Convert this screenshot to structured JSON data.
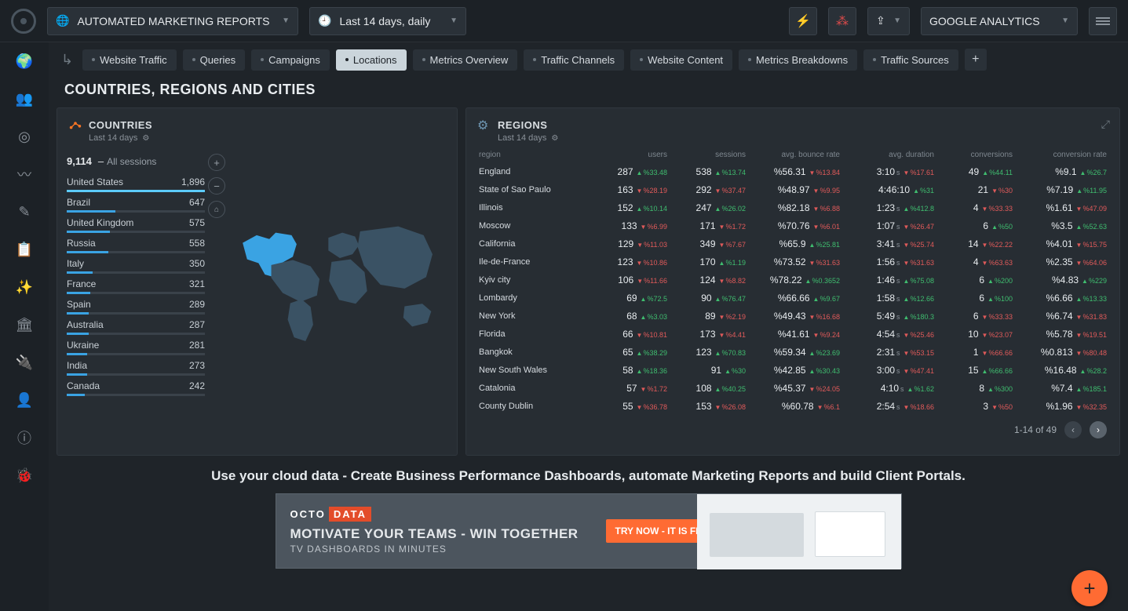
{
  "topbar": {
    "report_select": "AUTOMATED MARKETING REPORTS",
    "date_range": "Last 14 days, daily",
    "source_select": "GOOGLE ANALYTICS"
  },
  "tabs": [
    {
      "label": "Website Traffic",
      "active": false
    },
    {
      "label": "Queries",
      "active": false
    },
    {
      "label": "Campaigns",
      "active": false
    },
    {
      "label": "Locations",
      "active": true
    },
    {
      "label": "Metrics Overview",
      "active": false
    },
    {
      "label": "Traffic Channels",
      "active": false
    },
    {
      "label": "Website Content",
      "active": false
    },
    {
      "label": "Metrics Breakdowns",
      "active": false
    },
    {
      "label": "Traffic Sources",
      "active": false
    }
  ],
  "page_title": "COUNTRIES, REGIONS AND CITIES",
  "countries_panel": {
    "title": "COUNTRIES",
    "subtitle": "Last 14 days",
    "total_value": "9,114",
    "total_label": "All sessions",
    "rows": [
      {
        "name": "United States",
        "value": "1,896",
        "pct": 100
      },
      {
        "name": "Brazil",
        "value": "647",
        "pct": 35
      },
      {
        "name": "United Kingdom",
        "value": "575",
        "pct": 31
      },
      {
        "name": "Russia",
        "value": "558",
        "pct": 30
      },
      {
        "name": "Italy",
        "value": "350",
        "pct": 19
      },
      {
        "name": "France",
        "value": "321",
        "pct": 17
      },
      {
        "name": "Spain",
        "value": "289",
        "pct": 16
      },
      {
        "name": "Australia",
        "value": "287",
        "pct": 16
      },
      {
        "name": "Ukraine",
        "value": "281",
        "pct": 15
      },
      {
        "name": "India",
        "value": "273",
        "pct": 15
      },
      {
        "name": "Canada",
        "value": "242",
        "pct": 13
      }
    ]
  },
  "regions_panel": {
    "title": "REGIONS",
    "subtitle": "Last 14 days",
    "columns": [
      "region",
      "users",
      "sessions",
      "avg. bounce rate",
      "avg. duration",
      "conversions",
      "conversion rate"
    ],
    "rows": [
      {
        "region": "England",
        "users": "287",
        "users_chg": "%33.48",
        "users_dir": "up",
        "sessions": "538",
        "sessions_chg": "%13.74",
        "sessions_dir": "up",
        "bounce": "%56.31",
        "bounce_chg": "%13.84",
        "bounce_dir": "dn",
        "dur": "3:10",
        "dur_chg": "%17.61",
        "dur_dir": "dn",
        "conv": "49",
        "conv_chg": "%44.11",
        "conv_dir": "up",
        "rate": "%9.1",
        "rate_chg": "%26.7",
        "rate_dir": "up"
      },
      {
        "region": "State of Sao Paulo",
        "users": "163",
        "users_chg": "%28.19",
        "users_dir": "dn",
        "sessions": "292",
        "sessions_chg": "%37.47",
        "sessions_dir": "dn",
        "bounce": "%48.97",
        "bounce_chg": "%9.95",
        "bounce_dir": "dn",
        "dur": "4:46:10",
        "dur_chg": "%31",
        "dur_dir": "up",
        "conv": "21",
        "conv_chg": "%30",
        "conv_dir": "dn",
        "rate": "%7.19",
        "rate_chg": "%11.95",
        "rate_dir": "up"
      },
      {
        "region": "Illinois",
        "users": "152",
        "users_chg": "%10.14",
        "users_dir": "up",
        "sessions": "247",
        "sessions_chg": "%26.02",
        "sessions_dir": "up",
        "bounce": "%82.18",
        "bounce_chg": "%6.88",
        "bounce_dir": "dn",
        "dur": "1:23",
        "dur_chg": "%412.8",
        "dur_dir": "up",
        "conv": "4",
        "conv_chg": "%33.33",
        "conv_dir": "dn",
        "rate": "%1.61",
        "rate_chg": "%47.09",
        "rate_dir": "dn"
      },
      {
        "region": "Moscow",
        "users": "133",
        "users_chg": "%6.99",
        "users_dir": "dn",
        "sessions": "171",
        "sessions_chg": "%1.72",
        "sessions_dir": "dn",
        "bounce": "%70.76",
        "bounce_chg": "%6.01",
        "bounce_dir": "dn",
        "dur": "1:07",
        "dur_chg": "%26.47",
        "dur_dir": "dn",
        "conv": "6",
        "conv_chg": "%50",
        "conv_dir": "up",
        "rate": "%3.5",
        "rate_chg": "%52.63",
        "rate_dir": "up"
      },
      {
        "region": "California",
        "users": "129",
        "users_chg": "%11.03",
        "users_dir": "dn",
        "sessions": "349",
        "sessions_chg": "%7.67",
        "sessions_dir": "dn",
        "bounce": "%65.9",
        "bounce_chg": "%25.81",
        "bounce_dir": "up",
        "dur": "3:41",
        "dur_chg": "%25.74",
        "dur_dir": "dn",
        "conv": "14",
        "conv_chg": "%22.22",
        "conv_dir": "dn",
        "rate": "%4.01",
        "rate_chg": "%15.75",
        "rate_dir": "dn"
      },
      {
        "region": "Ile-de-France",
        "users": "123",
        "users_chg": "%10.86",
        "users_dir": "dn",
        "sessions": "170",
        "sessions_chg": "%1.19",
        "sessions_dir": "up",
        "bounce": "%73.52",
        "bounce_chg": "%31.63",
        "bounce_dir": "dn",
        "dur": "1:56",
        "dur_chg": "%31.63",
        "dur_dir": "dn",
        "conv": "4",
        "conv_chg": "%63.63",
        "conv_dir": "dn",
        "rate": "%2.35",
        "rate_chg": "%64.06",
        "rate_dir": "dn"
      },
      {
        "region": "Kyiv city",
        "users": "106",
        "users_chg": "%11.66",
        "users_dir": "dn",
        "sessions": "124",
        "sessions_chg": "%8.82",
        "sessions_dir": "dn",
        "bounce": "%78.22",
        "bounce_chg": "%0.3652",
        "bounce_dir": "up",
        "dur": "1:46",
        "dur_chg": "%75.08",
        "dur_dir": "up",
        "conv": "6",
        "conv_chg": "%200",
        "conv_dir": "up",
        "rate": "%4.83",
        "rate_chg": "%229",
        "rate_dir": "up"
      },
      {
        "region": "Lombardy",
        "users": "69",
        "users_chg": "%72.5",
        "users_dir": "up",
        "sessions": "90",
        "sessions_chg": "%76.47",
        "sessions_dir": "up",
        "bounce": "%66.66",
        "bounce_chg": "%9.67",
        "bounce_dir": "up",
        "dur": "1:58",
        "dur_chg": "%12.66",
        "dur_dir": "up",
        "conv": "6",
        "conv_chg": "%100",
        "conv_dir": "up",
        "rate": "%6.66",
        "rate_chg": "%13.33",
        "rate_dir": "up"
      },
      {
        "region": "New York",
        "users": "68",
        "users_chg": "%3.03",
        "users_dir": "up",
        "sessions": "89",
        "sessions_chg": "%2.19",
        "sessions_dir": "dn",
        "bounce": "%49.43",
        "bounce_chg": "%16.68",
        "bounce_dir": "dn",
        "dur": "5:49",
        "dur_chg": "%180.3",
        "dur_dir": "up",
        "conv": "6",
        "conv_chg": "%33.33",
        "conv_dir": "dn",
        "rate": "%6.74",
        "rate_chg": "%31.83",
        "rate_dir": "dn"
      },
      {
        "region": "Florida",
        "users": "66",
        "users_chg": "%10.81",
        "users_dir": "dn",
        "sessions": "173",
        "sessions_chg": "%4.41",
        "sessions_dir": "dn",
        "bounce": "%41.61",
        "bounce_chg": "%9.24",
        "bounce_dir": "dn",
        "dur": "4:54",
        "dur_chg": "%25.46",
        "dur_dir": "dn",
        "conv": "10",
        "conv_chg": "%23.07",
        "conv_dir": "dn",
        "rate": "%5.78",
        "rate_chg": "%19.51",
        "rate_dir": "dn"
      },
      {
        "region": "Bangkok",
        "users": "65",
        "users_chg": "%38.29",
        "users_dir": "up",
        "sessions": "123",
        "sessions_chg": "%70.83",
        "sessions_dir": "up",
        "bounce": "%59.34",
        "bounce_chg": "%23.69",
        "bounce_dir": "up",
        "dur": "2:31",
        "dur_chg": "%53.15",
        "dur_dir": "dn",
        "conv": "1",
        "conv_chg": "%66.66",
        "conv_dir": "dn",
        "rate": "%0.813",
        "rate_chg": "%80.48",
        "rate_dir": "dn"
      },
      {
        "region": "New South Wales",
        "users": "58",
        "users_chg": "%18.36",
        "users_dir": "up",
        "sessions": "91",
        "sessions_chg": "%30",
        "sessions_dir": "up",
        "bounce": "%42.85",
        "bounce_chg": "%30.43",
        "bounce_dir": "up",
        "dur": "3:00",
        "dur_chg": "%47.41",
        "dur_dir": "dn",
        "conv": "15",
        "conv_chg": "%66.66",
        "conv_dir": "up",
        "rate": "%16.48",
        "rate_chg": "%28.2",
        "rate_dir": "up"
      },
      {
        "region": "Catalonia",
        "users": "57",
        "users_chg": "%1.72",
        "users_dir": "dn",
        "sessions": "108",
        "sessions_chg": "%40.25",
        "sessions_dir": "up",
        "bounce": "%45.37",
        "bounce_chg": "%24.05",
        "bounce_dir": "dn",
        "dur": "4:10",
        "dur_chg": "%1.62",
        "dur_dir": "up",
        "conv": "8",
        "conv_chg": "%300",
        "conv_dir": "up",
        "rate": "%7.4",
        "rate_chg": "%185.1",
        "rate_dir": "up"
      },
      {
        "region": "County Dublin",
        "users": "55",
        "users_chg": "%36.78",
        "users_dir": "dn",
        "sessions": "153",
        "sessions_chg": "%26.08",
        "sessions_dir": "dn",
        "bounce": "%60.78",
        "bounce_chg": "%6.1",
        "bounce_dir": "dn",
        "dur": "2:54",
        "dur_chg": "%18.66",
        "dur_dir": "dn",
        "conv": "3",
        "conv_chg": "%50",
        "conv_dir": "dn",
        "rate": "%1.96",
        "rate_chg": "%32.35",
        "rate_dir": "dn"
      }
    ],
    "page_label": "1-14 of 49"
  },
  "promo": {
    "headline": "Use your cloud data - Create Business Performance Dashboards, automate Marketing Reports and build Client Portals.",
    "brand1": "OCTO",
    "brand2": "DATA",
    "line2": "MOTIVATE YOUR TEAMS - WIN TOGETHER",
    "line3": "TV DASHBOARDS IN MINUTES",
    "cta": "TRY NOW - IT IS FREE"
  }
}
